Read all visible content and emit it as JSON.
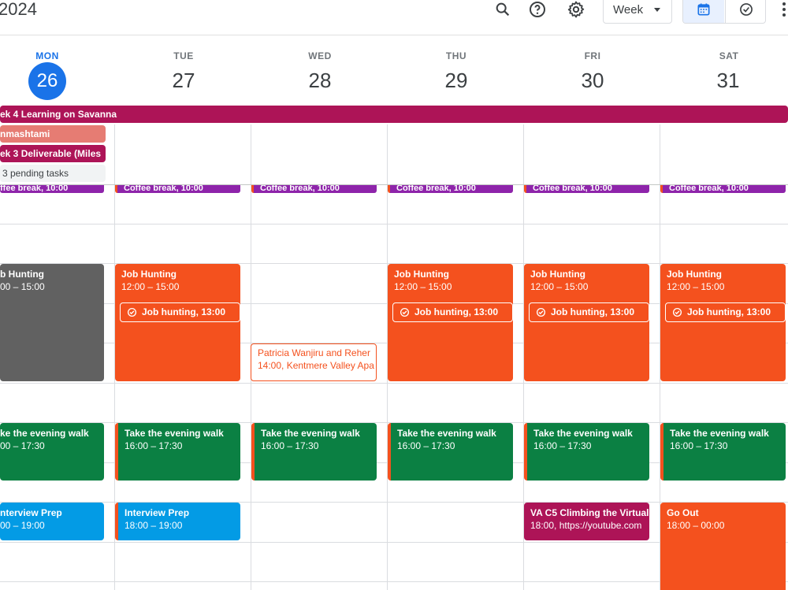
{
  "header": {
    "year_label": "2024",
    "view": "Week"
  },
  "days": [
    {
      "dow": "MON",
      "num": "26",
      "today": true
    },
    {
      "dow": "TUE",
      "num": "27"
    },
    {
      "dow": "WED",
      "num": "28"
    },
    {
      "dow": "THU",
      "num": "29"
    },
    {
      "dow": "FRI",
      "num": "30"
    },
    {
      "dow": "SAT",
      "num": "31"
    }
  ],
  "allday": {
    "banner": "ek 4 Learning on Savanna",
    "mon_1": "nmashtami",
    "mon_2": "ek 3 Deliverable (Miles",
    "mon_3": "3 pending tasks"
  },
  "coffee": {
    "mon": "ffee break, 10:00",
    "tue": "Coffee break, 10:00",
    "wed": "Coffee break, 10:00",
    "thu": "Coffee break, 10:00",
    "fri": "Coffee break, 10:00",
    "sat": "Coffee break, 10:00"
  },
  "job": {
    "mon_title": "b Hunting",
    "mon_time": "00 – 15:00",
    "title": "Job Hunting",
    "time": "12:00 – 15:00",
    "task": "Job hunting, 13:00"
  },
  "patricia": {
    "title": "Patricia Wanjiru and Reher",
    "sub": "14:00, Kentmere Valley Apa"
  },
  "walk": {
    "mon_title": "ke the evening walk",
    "mon_time": "00 – 17:30",
    "title": "Take the evening walk",
    "time": "16:00 – 17:30"
  },
  "interview": {
    "mon_title": "nterview Prep",
    "mon_time": "00 – 19:00",
    "title": "Interview Prep",
    "time": "18:00 – 19:00"
  },
  "va": {
    "title": "VA C5 Climbing the Virtual",
    "sub": "18:00, https://youtube.com"
  },
  "goout": {
    "title": "Go Out",
    "time": "18:00 – 00:00"
  },
  "colors": {
    "tangerine": "#f4511e",
    "basil": "#0b8043",
    "peacock": "#039be5",
    "grape": "#8e24aa",
    "beet": "#ad1457",
    "graphite": "#616161",
    "flamingo": "#e67c73",
    "blue": "#1a73e8"
  }
}
